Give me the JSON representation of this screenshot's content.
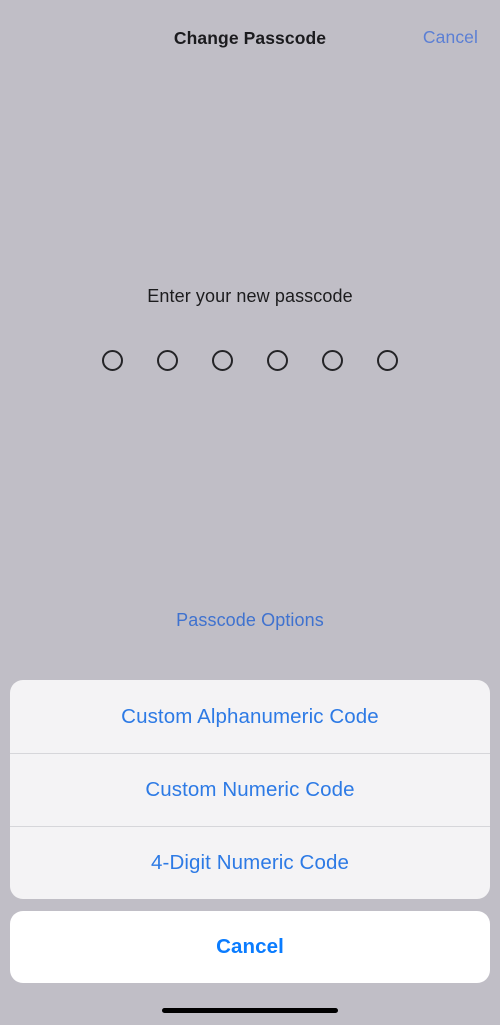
{
  "navbar": {
    "title": "Change Passcode",
    "cancel_label": "Cancel"
  },
  "passcode": {
    "prompt": "Enter your new passcode",
    "digit_count": 6,
    "entered_count": 0,
    "options_link_label": "Passcode Options"
  },
  "action_sheet": {
    "options": [
      {
        "label": "Custom Alphanumeric Code"
      },
      {
        "label": "Custom Numeric Code"
      },
      {
        "label": "4-Digit Numeric Code"
      }
    ],
    "cancel_label": "Cancel"
  },
  "colors": {
    "background": "#c0bec6",
    "accent_blue": "#0a7cff",
    "dimmed_blue": "#5b7fd4",
    "option_blue": "#2d7ae5",
    "sheet_background": "#f6f6f8",
    "cancel_background": "#ffffff",
    "separator": "#d6d6da",
    "title_text": "#1b1b1e",
    "home_indicator": "#000000"
  }
}
